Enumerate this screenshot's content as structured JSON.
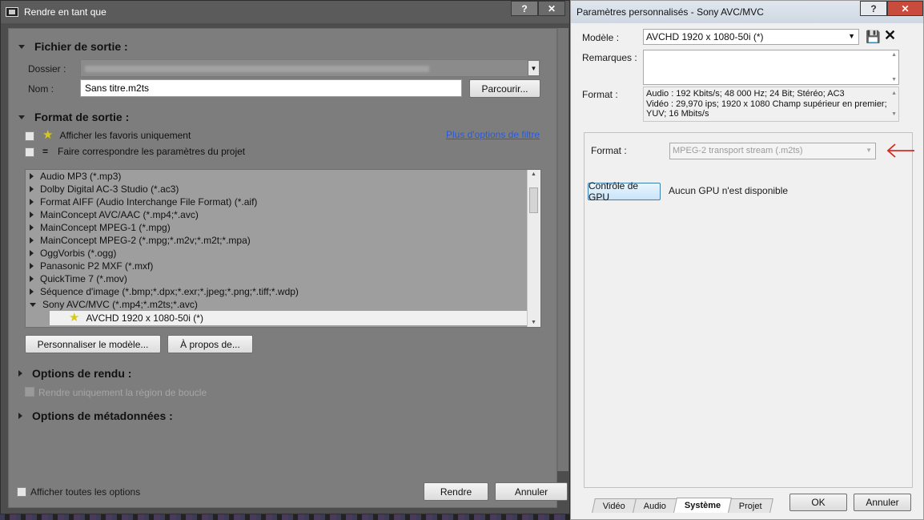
{
  "left_dialog": {
    "title": "Rendre en tant que",
    "help_glyph": "?",
    "close_glyph": "✕",
    "output_file_section": "Fichier de sortie :",
    "folder_label": "Dossier :",
    "name_label": "Nom :",
    "name_value": "Sans titre.m2ts",
    "browse_button": "Parcourir...",
    "output_format_section": "Format de sortie :",
    "favorites_only_label": "Afficher les favoris uniquement",
    "match_project_label": "Faire correspondre les paramètres du projet",
    "more_filter_link": "Plus d'options de filtre",
    "formats": [
      "Audio MP3 (*.mp3)",
      "Dolby Digital AC-3 Studio (*.ac3)",
      "Format AIFF (Audio Interchange File Format) (*.aif)",
      "MainConcept AVC/AAC (*.mp4;*.avc)",
      "MainConcept MPEG-1 (*.mpg)",
      "MainConcept MPEG-2 (*.mpg;*.m2v;*.m2t;*.mpa)",
      "OggVorbis (*.ogg)",
      "Panasonic P2 MXF (*.mxf)",
      "QuickTime 7 (*.mov)",
      "Séquence d'image (*.bmp;*.dpx;*.exr;*.jpeg;*.png;*.tiff;*.wdp)",
      "Sony AVC/MVC (*.mp4;*.m2ts;*.avc)"
    ],
    "selected_template": "AVCHD 1920 x 1080-50i (*)",
    "customize_button": "Personnaliser le modèle...",
    "about_button": "À propos de...",
    "render_options_section": "Options de rendu :",
    "loop_region_label": "Rendre uniquement la région de boucle",
    "metadata_section": "Options de métadonnées :",
    "show_all_label": "Afficher toutes les options",
    "render_button": "Rendre",
    "cancel_button": "Annuler"
  },
  "right_dialog": {
    "title": "Paramètres personnalisés - Sony AVC/MVC",
    "help_glyph": "?",
    "close_glyph": "✕",
    "template_label": "Modèle :",
    "template_value": "AVCHD 1920 x 1080-50i (*)",
    "remarks_label": "Remarques :",
    "format_label": "Format :",
    "format_lines": [
      "Audio : 192 Kbits/s; 48 000 Hz; 24 Bit; Stéréo; AC3",
      "Vidéo : 29,970 ips; 1920 x 1080 Champ supérieur en premier;",
      "YUV; 16 Mbits/s"
    ],
    "system_format_label": "Format :",
    "system_format_value": "MPEG-2 transport stream (.m2ts)",
    "gpu_button": "Contrôle de GPU",
    "gpu_status": "Aucun GPU n'est disponible",
    "tabs": [
      "Vidéo",
      "Audio",
      "Système",
      "Projet"
    ],
    "active_tab": "Système",
    "ok_button": "OK",
    "cancel_button": "Annuler"
  },
  "colors": {
    "left_bg": "#7d7d7d",
    "link": "#2b5bd6",
    "annotation_arrow": "#d92a1c"
  }
}
